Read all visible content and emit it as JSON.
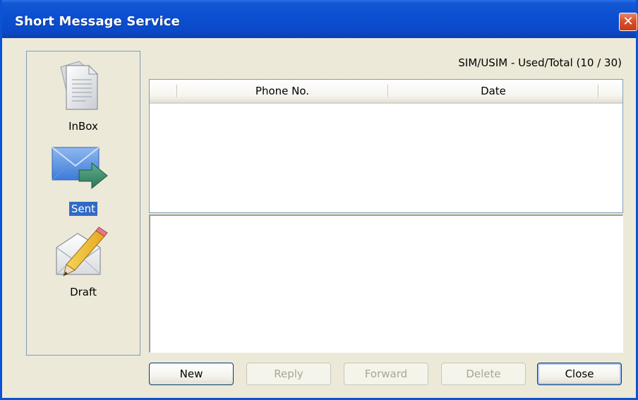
{
  "window": {
    "title": "Short Message Service",
    "close_glyph": "✕"
  },
  "sidebar": {
    "items": [
      {
        "label": "InBox",
        "icon": "inbox-document-icon",
        "selected": false
      },
      {
        "label": "Sent",
        "icon": "sent-envelope-arrow-icon",
        "selected": true
      },
      {
        "label": "Draft",
        "icon": "draft-envelope-pencil-icon",
        "selected": false
      }
    ]
  },
  "storage": {
    "usage_text": "SIM/USIM - Used/Total (10 / 30)"
  },
  "message_list": {
    "columns": [
      "",
      "Phone No.",
      "Date"
    ],
    "rows": []
  },
  "message_preview": {
    "text": ""
  },
  "buttons": {
    "new": {
      "label": "New",
      "enabled": true
    },
    "reply": {
      "label": "Reply",
      "enabled": false
    },
    "forward": {
      "label": "Forward",
      "enabled": false
    },
    "delete": {
      "label": "Delete",
      "enabled": false
    },
    "close": {
      "label": "Close",
      "enabled": true
    }
  },
  "colors": {
    "titlebar": "#0a4ac9",
    "window_bg": "#ece9d8",
    "selection": "#316ac5",
    "close_button": "#d9532e"
  }
}
